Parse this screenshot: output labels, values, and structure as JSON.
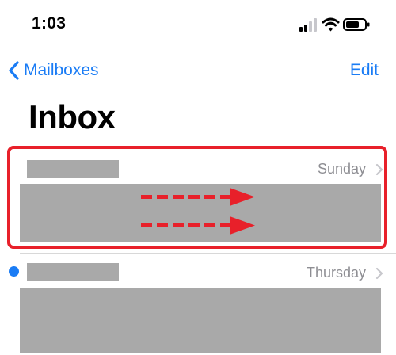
{
  "status_bar": {
    "time": "1:03",
    "icons": [
      "cellular-signal-icon",
      "wifi-icon",
      "battery-icon"
    ]
  },
  "nav": {
    "back_label": "Mailboxes",
    "edit_label": "Edit"
  },
  "page_title": "Inbox",
  "messages": [
    {
      "date": "Sunday",
      "unread": false,
      "sender": "redacted",
      "preview": "redacted"
    },
    {
      "date": "Thursday",
      "unread": true,
      "sender": "redacted",
      "preview": "redacted"
    }
  ],
  "annotation": {
    "highlight_color": "#e8202a",
    "gesture": "swipe-right"
  },
  "colors": {
    "accent": "#1a7cf5",
    "secondary_text": "#8e8e93",
    "redaction": "#a9a9a9"
  }
}
